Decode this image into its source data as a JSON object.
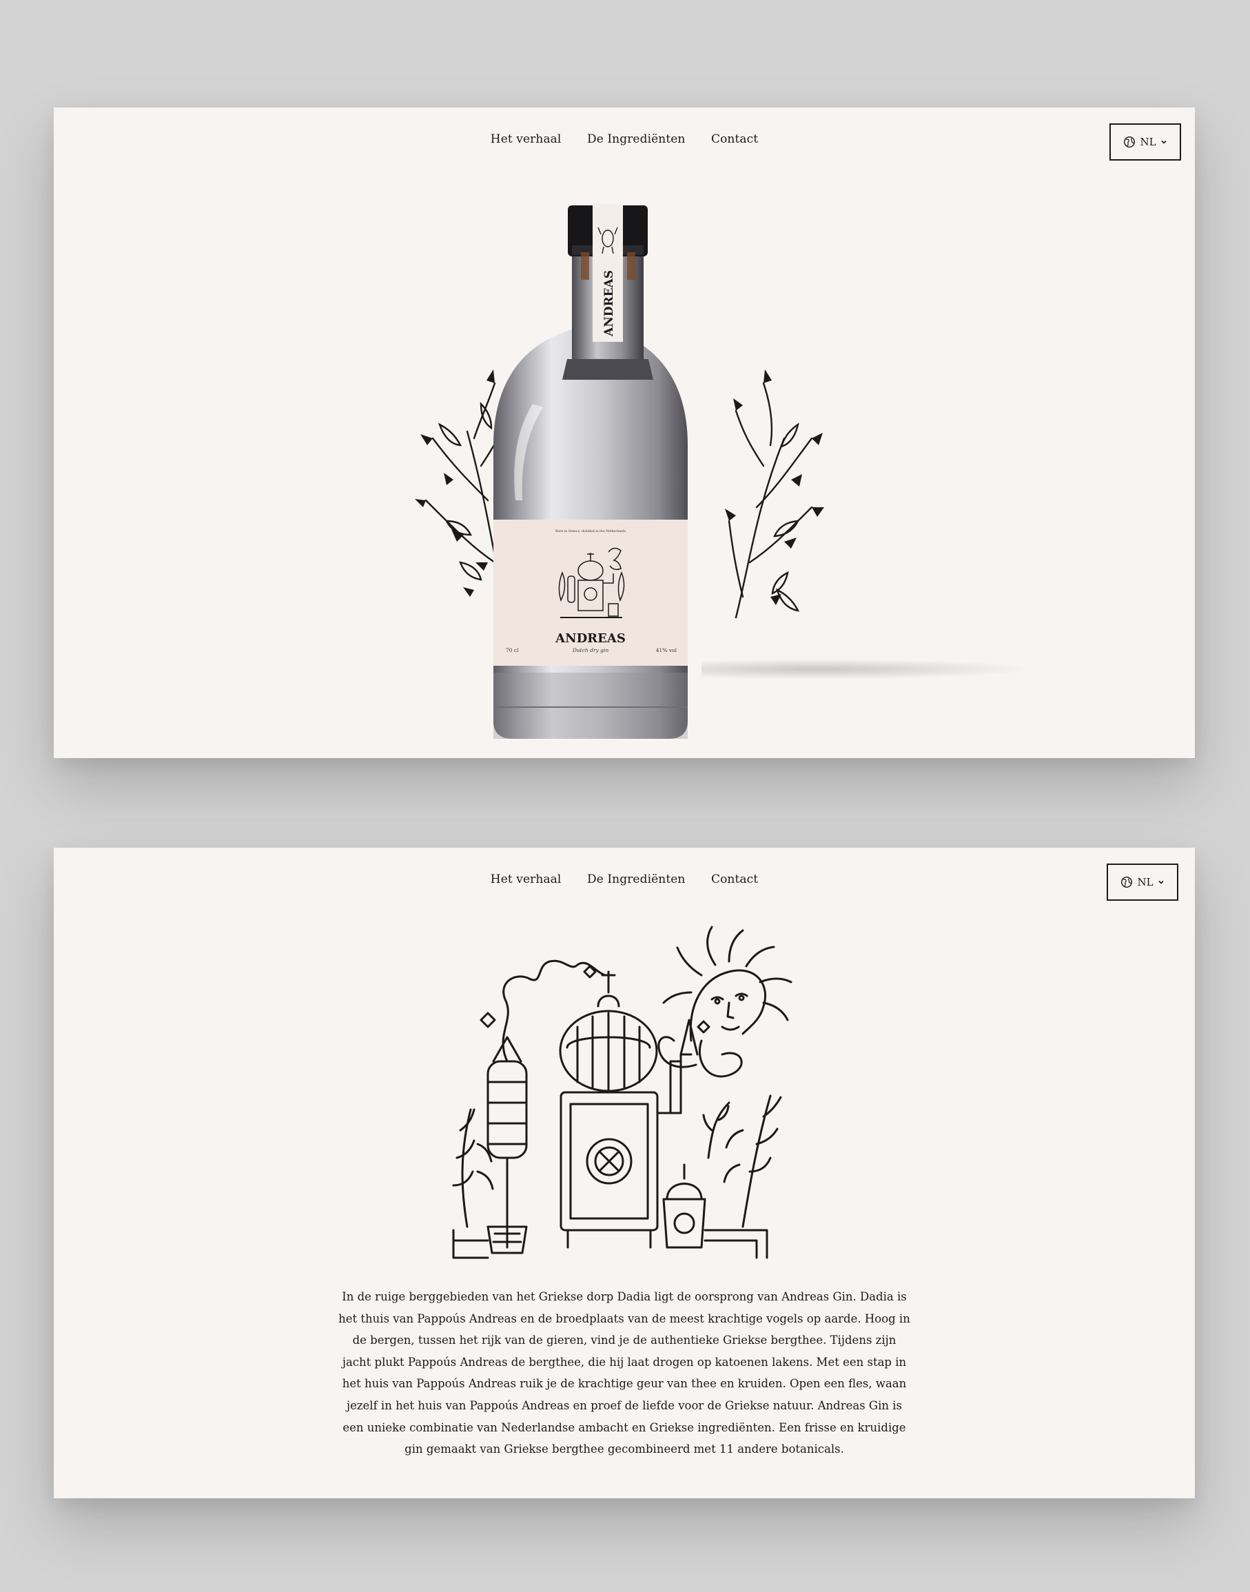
{
  "nav": {
    "items": [
      {
        "label": "Het verhaal"
      },
      {
        "label": "De Ingrediënten"
      },
      {
        "label": "Contact"
      }
    ]
  },
  "language": {
    "current": "NL"
  },
  "bottle": {
    "neck_label": "ANDREAS",
    "label_small_print": "Born in Greece, distilled in the Netherlands",
    "brand": "ANDREAS",
    "subtitle": "Dutch dry gin",
    "volume": "70 cl",
    "abv": "41% vol"
  },
  "story": {
    "text": "In de ruige berggebieden van het Griekse dorp Dadia ligt de oorsprong van Andreas Gin. Dadia is het thuis van Pappoús Andreas en de broedplaats van de meest krachtige vogels op aarde. Hoog in de bergen, tussen het rijk van de gieren, vind je de authentieke Griekse bergthee. Tijdens zijn jacht plukt Pappoús Andreas de bergthee, die hij laat drogen op katoenen lakens. Met een stap in het huis van Pappoús Andreas ruik je de krachtige geur van thee en kruiden. Open een fles, waan jezelf in het huis van Pappoús Andreas en proef de liefde voor de Griekse natuur. Andreas Gin is een unieke combinatie van Nederlandse ambacht en Griekse ingrediënten. Een frisse en kruidige gin gemaakt van Griekse bergthee gecombineerd met 11 andere botanicals."
  },
  "colors": {
    "page_background": "#d3d3d3",
    "panel_background": "#f7f4f2",
    "ink": "#1c1a19",
    "label": "#f0e6df"
  }
}
